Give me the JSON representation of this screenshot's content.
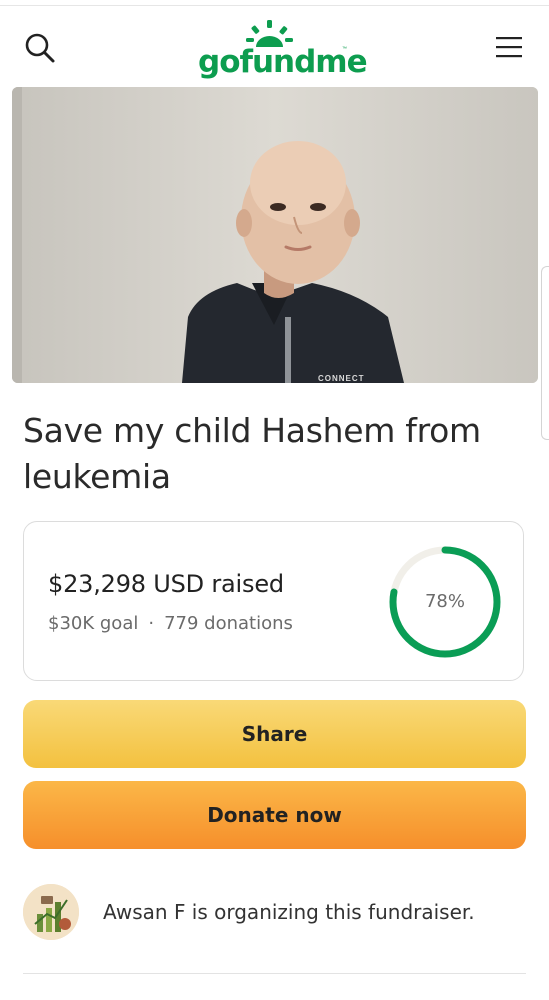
{
  "header": {
    "logo_text": "gofundme",
    "logo_tm": "™",
    "search_icon": "search-icon",
    "menu_icon": "hamburger-menu-icon",
    "brand_color": "#0d9d4f"
  },
  "campaign": {
    "title": "Save my child Hashem from leukemia",
    "photo_shirt_text": "CONNECT"
  },
  "stats": {
    "raised": "$23,298 USD raised",
    "goal": "$30K goal",
    "separator": "·",
    "donations": "779 donations",
    "progress_label": "78%",
    "progress_fraction": 0.78,
    "progress_color": "#0a9d55"
  },
  "actions": {
    "share_label": "Share",
    "donate_label": "Donate now",
    "share_color": "#f6cd58",
    "donate_color": "#f9a23a"
  },
  "organizer": {
    "text": "Awsan F is organizing this fundraiser.",
    "avatar_icon": "organizer-avatar"
  }
}
